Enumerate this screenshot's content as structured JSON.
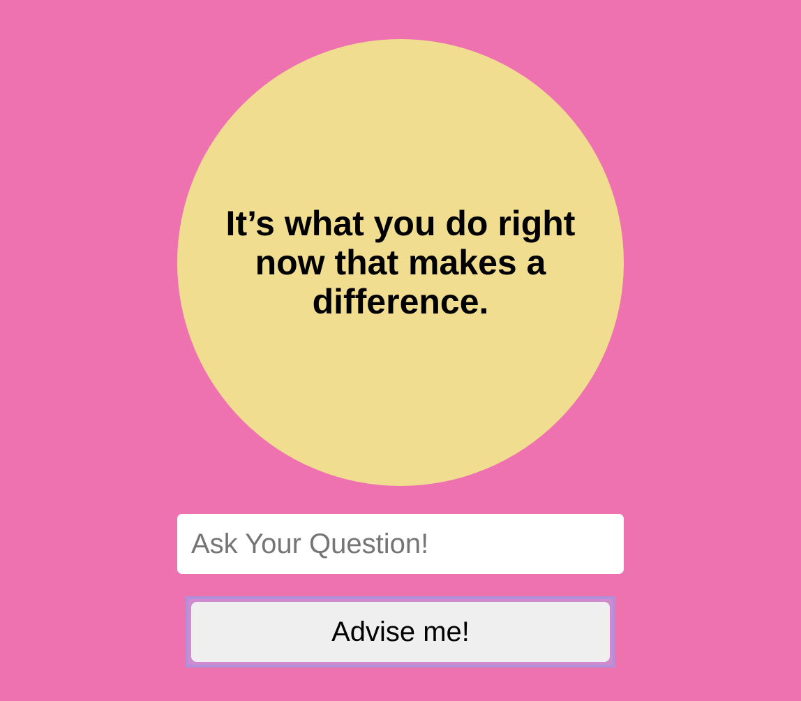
{
  "eight_ball": {
    "answer": "It’s what you do right now that makes a difference."
  },
  "question": {
    "value": "",
    "placeholder": "Ask Your Question!"
  },
  "advise_button": {
    "label": "Advise me!"
  },
  "colors": {
    "background": "#ee72b0",
    "ball": "#f0dd90",
    "focus_ring": "#b090d8",
    "button": "#efefef"
  }
}
